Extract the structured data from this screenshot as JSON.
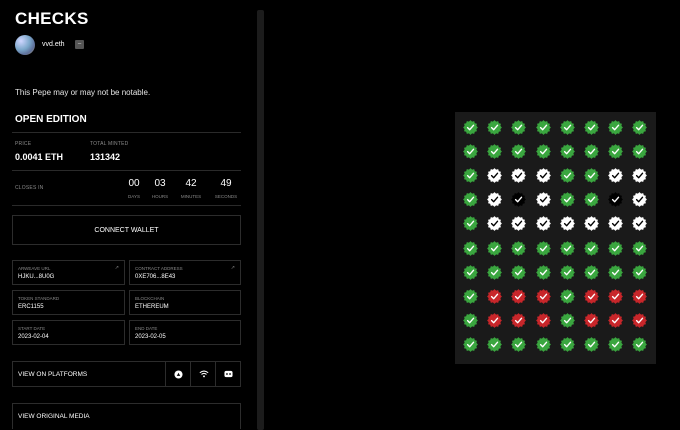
{
  "title": "CHECKS",
  "creator": {
    "name": "vvd.eth",
    "badge": "–"
  },
  "description": "This Pepe may or may not be notable.",
  "edition": "OPEN EDITION",
  "stats": {
    "price_label": "PRICE",
    "price": "0.0041 ETH",
    "minted_label": "TOTAL MINTED",
    "minted": "131342"
  },
  "countdown": {
    "label": "CLOSES IN",
    "units": [
      {
        "value": "00",
        "label": "DAYS"
      },
      {
        "value": "03",
        "label": "HOURS"
      },
      {
        "value": "42",
        "label": "MINUTES"
      },
      {
        "value": "49",
        "label": "SECONDS"
      }
    ]
  },
  "connect_label": "CONNECT WALLET",
  "fields": {
    "arweave_label": "ARWEAVE URL",
    "arweave": "HJKU...8U0G",
    "contract_label": "CONTRACT ADDRESS",
    "contract": "0XE706...8E43",
    "standard_label": "TOKEN STANDARD",
    "standard": "ERC1155",
    "chain_label": "BLOCKCHAIN",
    "chain": "ETHEREUM",
    "start_label": "START DATE",
    "start": "2023-02-04",
    "end_label": "END DATE",
    "end": "2023-02-05"
  },
  "platforms_label": "VIEW ON PLATFORMS",
  "media_label": "VIEW ORIGINAL MEDIA",
  "colors": {
    "green": "#3aa63f",
    "red": "#c8262a",
    "white": "#ffffff",
    "black": "#000000",
    "art_bg": "#1a1a1a"
  },
  "grid": [
    "gggggggg",
    "gggggggg",
    "gwwwggww",
    "gwbwggbw",
    "gwwwwwww",
    "gggggggg",
    "gggggggg",
    "grrrgrrr",
    "grrrgrrr",
    "gggggggg"
  ]
}
